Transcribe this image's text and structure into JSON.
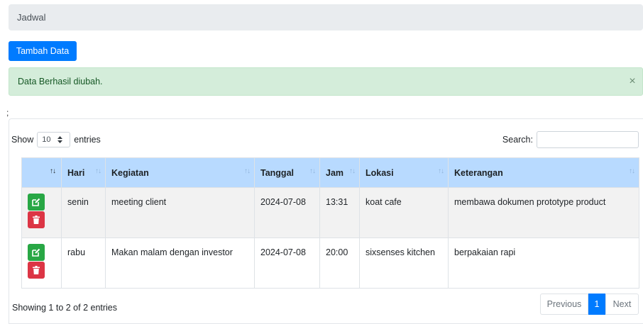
{
  "breadcrumb": {
    "label": "Jadwal"
  },
  "toolbar": {
    "add_label": "Tambah Data"
  },
  "alert": {
    "message": "Data Berhasil diubah.",
    "close": "×"
  },
  "stray_text": ";",
  "table_controls": {
    "show_label": "Show",
    "entries_label": "entries",
    "page_length": "10",
    "search_label": "Search:",
    "search_value": ""
  },
  "table": {
    "columns": [
      "",
      "Hari",
      "Kegiatan",
      "Tanggal",
      "Jam",
      "Lokasi",
      "Keterangan"
    ],
    "sort_icon": "↑↓",
    "rows": [
      {
        "hari": "senin",
        "kegiatan": "meeting client",
        "tanggal": "2024-07-08",
        "jam": "13:31",
        "lokasi": "koat cafe",
        "keterangan": "membawa dokumen prototype product"
      },
      {
        "hari": "rabu",
        "kegiatan": "Makan malam dengan investor",
        "tanggal": "2024-07-08",
        "jam": "20:00",
        "lokasi": "sixsenses kitchen",
        "keterangan": "berpakaian rapi"
      }
    ]
  },
  "footer": {
    "info": "Showing 1 to 2 of 2 entries",
    "prev": "Previous",
    "current": "1",
    "next": "Next"
  },
  "colors": {
    "primary": "#007bff",
    "success": "#28a745",
    "danger": "#dc3545",
    "header_bg": "#b8daff",
    "alert_bg": "#d4edda"
  },
  "icons": {
    "edit": "edit-icon",
    "delete": "trash-icon",
    "select_arrows": "sort-arrows-icon"
  }
}
